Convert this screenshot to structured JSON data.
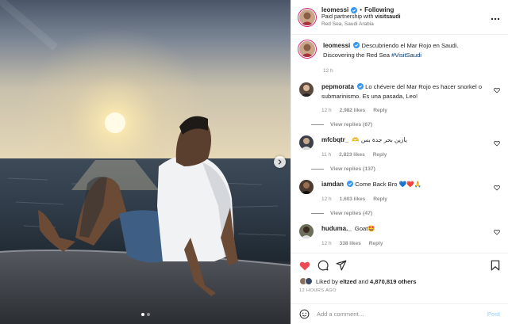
{
  "header": {
    "username": "leomessi",
    "separator": "•",
    "follow_label": "Following",
    "paid_partnership_prefix": "Paid partnership with",
    "paid_partner": "visitsaudi",
    "location": "Red Sea, Saudi Arabia",
    "more_icon": "more-horizontal-icon"
  },
  "caption": {
    "username": "leomessi",
    "text_line1": "Descubriendo el Mar Rojo en Saudi.",
    "text_line2": "Discovering the Red Sea",
    "hashtag": "#VisitSaudi",
    "age": "12 h"
  },
  "comments": [
    {
      "username": "pepmorata",
      "verified": true,
      "text": "Lo chévere del Mar Rojo es hacer snorkel o submarinismo. Es una pasada, Leo!",
      "age": "12 h",
      "likes": "2,982 likes",
      "reply": "Reply",
      "view_replies": "View replies (67)",
      "avatar_color": "#5a4a3e"
    },
    {
      "username": "mfcbqtr_",
      "verified": false,
      "text": "يازين بحر جدة بس 🫶",
      "age": "11 h",
      "likes": "2,823 likes",
      "reply": "Reply",
      "view_replies": "View replies (137)",
      "avatar_color": "#3b3f4a"
    },
    {
      "username": "iamdan",
      "verified": true,
      "text": "Come Back Bro 💙❤️🙏",
      "age": "12 h",
      "likes": "1,603 likes",
      "reply": "Reply",
      "view_replies": "View replies (47)",
      "avatar_color": "#4a3a30"
    },
    {
      "username": "huduma._",
      "verified": false,
      "text": "Goat🤩",
      "age": "12 h",
      "likes": "338 likes",
      "reply": "Reply",
      "avatar_color": "#6b6f5a"
    }
  ],
  "actions": {
    "like_icon": "heart-filled-icon",
    "comment_icon": "comment-icon",
    "share_icon": "share-icon",
    "save_icon": "bookmark-icon",
    "liked_by_prefix": "Liked by",
    "liked_by_user": "eltzed",
    "liked_by_and": "and",
    "liked_by_count": "4,870,819 others",
    "timestamp": "12 HOURS AGO",
    "like_color": "#ed4956"
  },
  "add_comment": {
    "emoji_icon": "emoji-icon",
    "placeholder": "Add a comment…",
    "post_label": "Post"
  },
  "media": {
    "next_icon": "chevron-right-icon",
    "slides": 2,
    "active_slide": 1
  }
}
